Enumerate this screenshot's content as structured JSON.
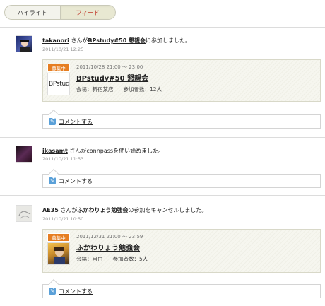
{
  "tabs": [
    {
      "label": "ハイライト"
    },
    {
      "label": "フィード"
    }
  ],
  "feed": [
    {
      "user": "takanori",
      "connector": " さんが",
      "event_link": "BPstudy#50 懇親会",
      "action": "に参加しました。",
      "date": "2011/10/21 12:25",
      "card": {
        "badge": "募集中",
        "datetime": "2011/10/28 21:00 〜 23:00",
        "title": "BPstudy#50 懇親会",
        "venue": "会場：新宿某店",
        "participants": "参加者数：12人",
        "thumb_text": "BPstudy"
      },
      "comment_label": "コメントする"
    },
    {
      "user": "ikasamt",
      "connector": " さんが",
      "action": "connpassを使い始めました。",
      "date": "2011/10/21 11:53",
      "comment_label": "コメントする"
    },
    {
      "user": "AE35",
      "connector": " さんが",
      "event_link": "ふかわりょう勉強会",
      "action": "の参加をキャンセルしました。",
      "date": "2011/10/21 10:50",
      "card": {
        "badge": "募集中",
        "datetime": "2011/12/31 21:00 〜 23:59",
        "title": "ふかわりょう勉強会",
        "venue": "会場：目白",
        "participants": "参加者数：5人"
      },
      "comment_label": "コメントする"
    }
  ],
  "colors": {
    "badge": "#e67e22",
    "active_tab_text": "#c0392b",
    "pen_icon": "#5aa0d8"
  }
}
